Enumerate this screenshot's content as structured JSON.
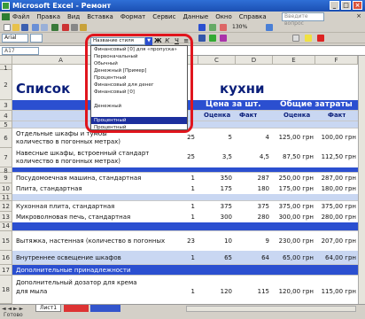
{
  "window": {
    "title": "Microsoft Excel - Ремонт"
  },
  "menu": {
    "items": [
      "Файл",
      "Правка",
      "Вид",
      "Вставка",
      "Формат",
      "Сервис",
      "Данные",
      "Окно",
      "Справка"
    ],
    "help_placeholder": "Введите вопрос"
  },
  "toolbar": {
    "zoom": "130%",
    "font_name": "Arial",
    "font_size": "10"
  },
  "formula_bar": {
    "name_box": "A17"
  },
  "style_dropdown": {
    "selected": "Название стиля",
    "items": [
      "Финансовый [0] для «пропуска»",
      "Первоначальный",
      "Обычный",
      "Денежный [Пример]",
      "Процентный",
      "Финансовый для денег",
      "Финансовый [0]",
      "",
      "Денежный",
      "",
      "Процентный",
      "Процентный"
    ],
    "selected_index": 10
  },
  "sheet": {
    "columns": [
      "A",
      "B",
      "C",
      "D",
      "E",
      "F"
    ],
    "rows": [
      "1",
      "2",
      "3",
      "4",
      "5",
      "6",
      "7",
      "8",
      "9",
      "10",
      "11",
      "12",
      "13",
      "14",
      "15",
      "16",
      "17",
      "18"
    ],
    "title_left": "Список",
    "title_right": "кухни",
    "header_price": "Цена за шт.",
    "header_total": "Общие затраты",
    "sub_estimate": "Оценка",
    "sub_fact": "Факт",
    "sub_estimate2": "Оценка",
    "sub_fact2": "Факт",
    "data_rows": [
      {
        "name": "Отдельные шкафы и тумбы",
        "name2": "количество в погонных метрах)",
        "qty": "25",
        "est": "5",
        "fact": "4",
        "total_est": "125,00 грн",
        "total_fact": "100,00 грн"
      },
      {
        "name": "Навесные шкафы, встроенный стандарт",
        "name2": "количество в погонных метрах)",
        "qty": "25",
        "est": "3,5",
        "fact": "4,5",
        "total_est": "87,50 грн",
        "total_fact": "112,50 грн"
      },
      {
        "name": "Посудомоечная машина, стандартная",
        "name2": "",
        "qty": "1",
        "est": "350",
        "fact": "287",
        "total_est": "250,00 грн",
        "total_fact": "287,00 грн"
      },
      {
        "name": "Плита, стандартная",
        "name2": "",
        "qty": "1",
        "est": "175",
        "fact": "180",
        "total_est": "175,00 грн",
        "total_fact": "180,00 грн"
      },
      {
        "name": "Кухонная плита, стандартная",
        "name2": "",
        "qty": "1",
        "est": "375",
        "fact": "375",
        "total_est": "375,00 грн",
        "total_fact": "375,00 грн"
      },
      {
        "name": "Микроволновая печь, стандартная",
        "name2": "",
        "qty": "1",
        "est": "300",
        "fact": "280",
        "total_est": "300,00 грн",
        "total_fact": "280,00 грн"
      },
      {
        "name": "Вытяжка, настенная (количество в погонных метрах)",
        "name2": "",
        "qty": "23",
        "est": "10",
        "fact": "9",
        "total_est": "230,00 грн",
        "total_fact": "207,00 грн"
      },
      {
        "name": "Внутреннее освещение шкафов",
        "name2": "",
        "qty": "1",
        "est": "65",
        "fact": "64",
        "total_est": "65,00 грн",
        "total_fact": "64,00 грн"
      },
      {
        "name": "Дополнительные принадлежности",
        "name2": "",
        "qty": "",
        "est": "",
        "fact": "",
        "total_est": "",
        "total_fact": ""
      },
      {
        "name": "Дополнительный дозатор для крема",
        "name2": "для мыла",
        "qty": "1",
        "est": "120",
        "fact": "115",
        "total_est": "120,00 грн",
        "total_fact": "115,00 грн"
      }
    ]
  },
  "tabs": {
    "sheet_name": "Лист1"
  },
  "status": {
    "text": "Готово"
  },
  "colors": {
    "band_blue": "#2b4fd0",
    "title_navy": "#0b1f7a",
    "highlight_red": "#e0151d"
  }
}
